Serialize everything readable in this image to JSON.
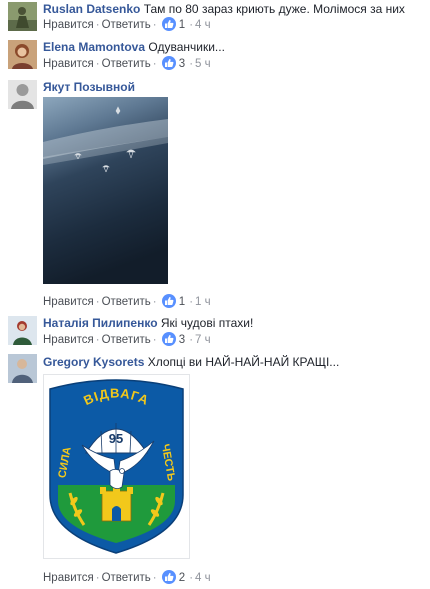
{
  "comments": [
    {
      "author": "Ruslan Datsenko",
      "text": "Там по 80 зараз криють дуже. Молімося за них",
      "like_label": "Нравится",
      "reply_label": "Ответить",
      "likes": "1",
      "time": "4 ч"
    },
    {
      "author": "Elena Mamontova",
      "text": "Одуванчики...",
      "like_label": "Нравится",
      "reply_label": "Ответить",
      "likes": "3",
      "time": "5 ч"
    },
    {
      "author": "Якут Позывной",
      "text": "",
      "like_label": "Нравится",
      "reply_label": "Ответить",
      "likes": "1",
      "time": "1 ч"
    },
    {
      "author": "Наталія Пилипенко",
      "text": "Які чудові птахи!",
      "like_label": "Нравится",
      "reply_label": "Ответить",
      "likes": "3",
      "time": "7 ч"
    },
    {
      "author": "Gregory Kysorets",
      "text": "Хлопці ви НАЙ-НАЙ-НАЙ КРАЩІ...",
      "like_label": "Нравится",
      "reply_label": "Ответить",
      "likes": "2",
      "time": "4 ч"
    }
  ],
  "emblem": {
    "arc_text": "ВІДВАГА",
    "left_text": "СИЛА",
    "right_text": "ЧЕСТЬ",
    "number": "95"
  },
  "icons": {
    "like": "thumbs-up-icon"
  },
  "colors": {
    "author": "#365899",
    "like_badge": "#5890ff",
    "meta": "#90949c"
  }
}
